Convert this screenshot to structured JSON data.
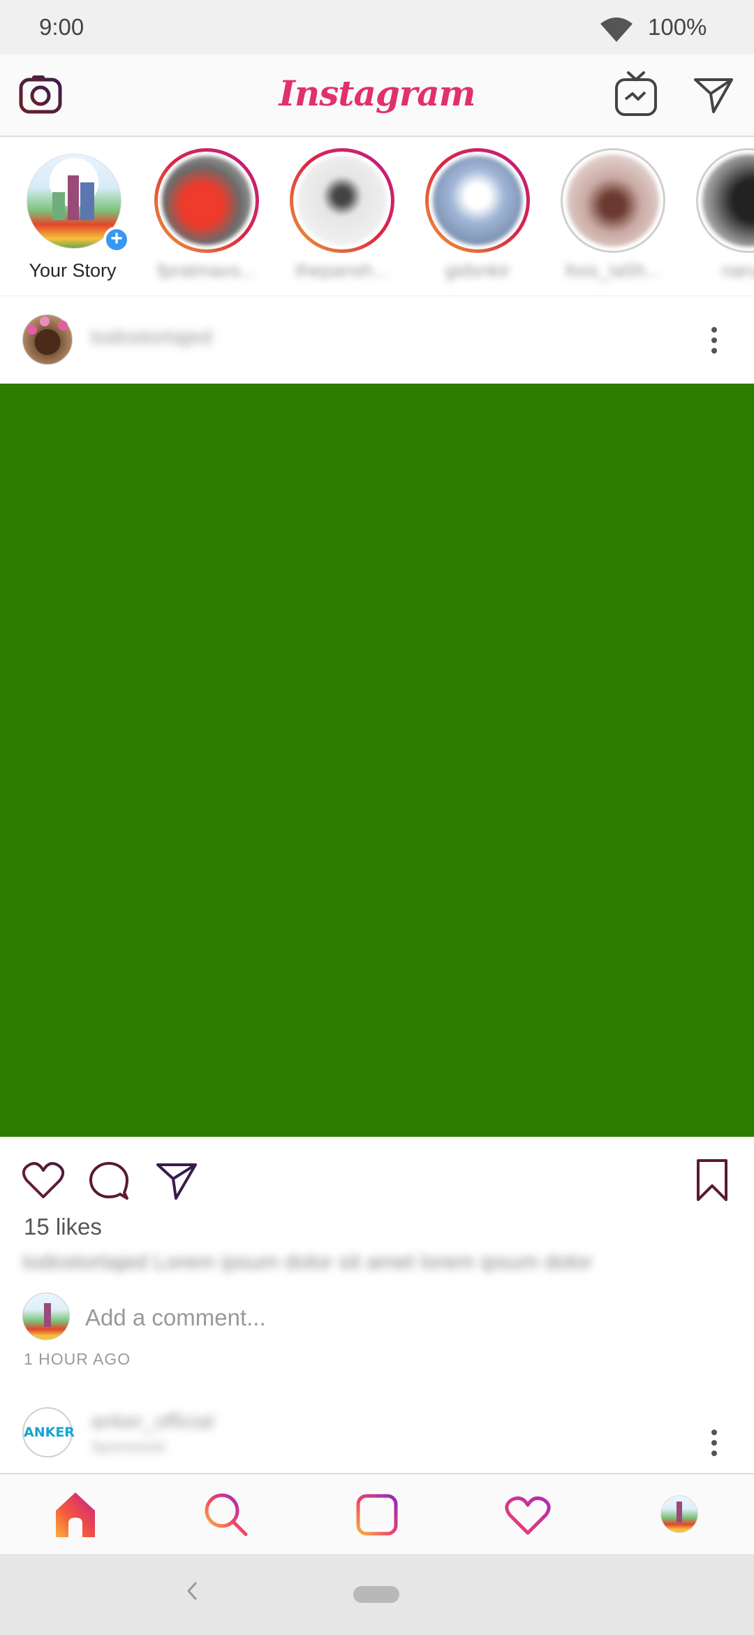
{
  "status_bar": {
    "time": "9:00",
    "battery": "100%"
  },
  "app_bar": {
    "title": "Instagram"
  },
  "stories": [
    {
      "label": "Your Story",
      "type": "own"
    },
    {
      "label": "fpratmaxs...",
      "type": "live",
      "color": "#d23a2a"
    },
    {
      "label": "thepansh...",
      "type": "live",
      "color": "#8a8a8a"
    },
    {
      "label": "gidsnkir",
      "type": "live",
      "color": "#9ab0d0"
    },
    {
      "label": "Itxis_Ia5h...",
      "type": "seen",
      "color": "#a0706a"
    },
    {
      "label": "naruto",
      "type": "seen",
      "color": "#444444"
    }
  ],
  "post": {
    "username": "todostortajed",
    "image_color": "#2d7d00",
    "likes": "15 likes",
    "caption": "todostortajed Lorem ipsum dolor sit amet lorem ipsum dolor",
    "comment_placeholder": "Add a comment...",
    "time_ago": "1 HOUR AGO"
  },
  "next_post": {
    "username": "anker_official",
    "subtitle": "Sponsored",
    "avatar_text": "ANKER"
  },
  "colors": {
    "accent": "#e1306c",
    "blue": "#3897f0",
    "post_green": "#2d7d00"
  }
}
